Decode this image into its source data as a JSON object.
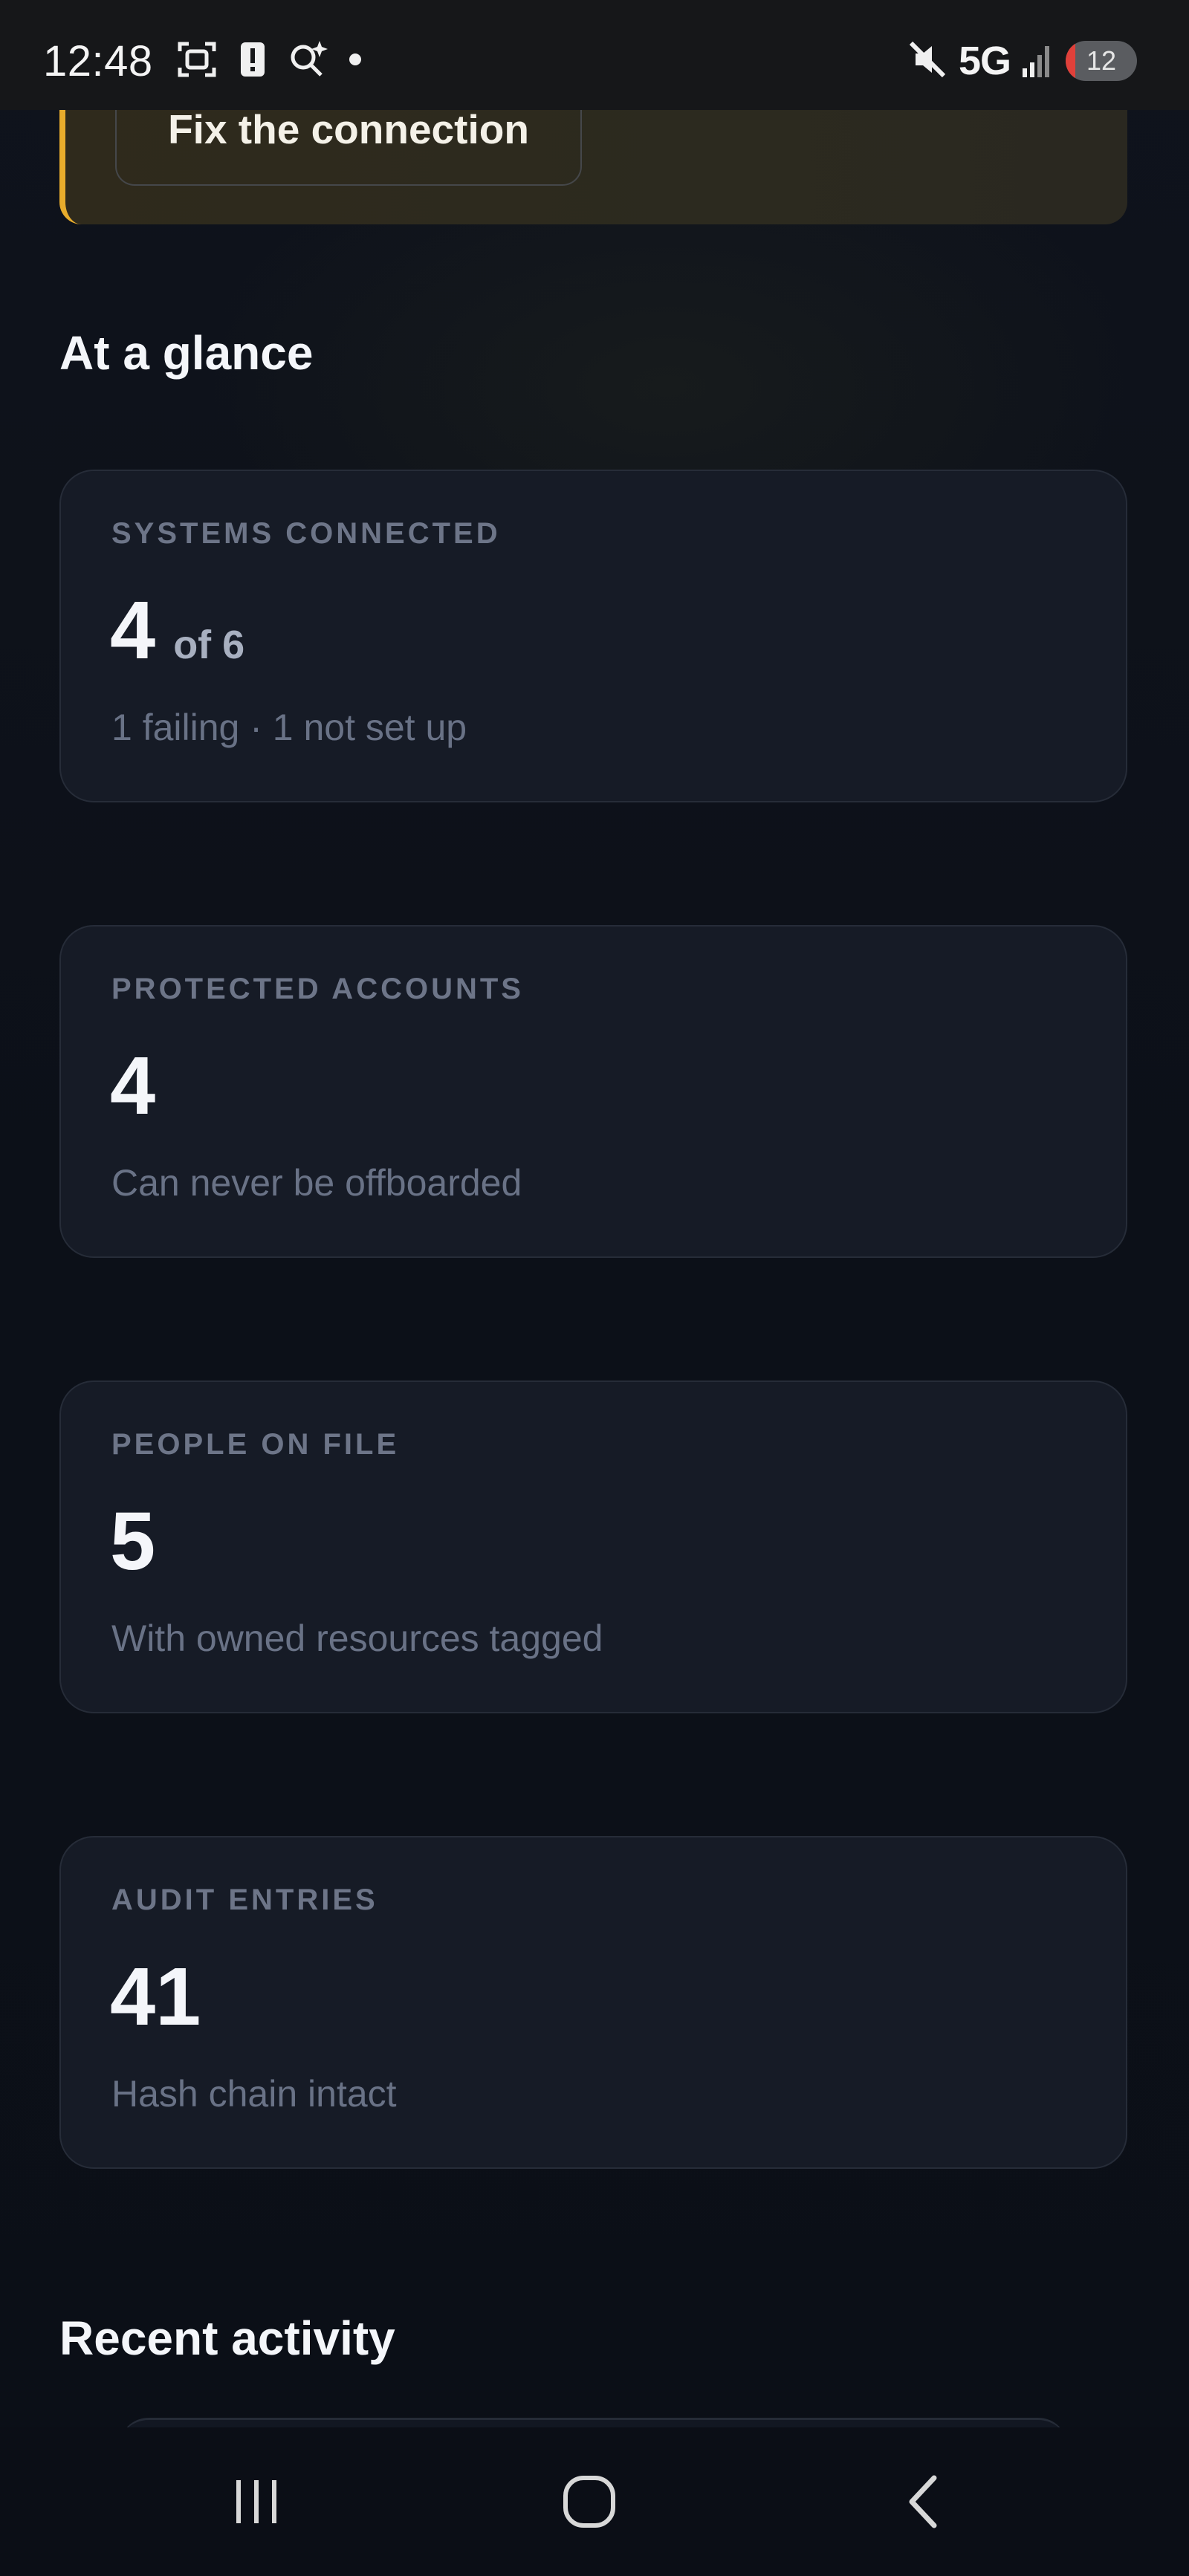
{
  "status_bar": {
    "time": "12:48",
    "network": "5G",
    "battery_level": "12",
    "icons": [
      "screenshot-icon",
      "alert-icon",
      "search-sparkle-icon",
      "notification-dot-icon",
      "mute-icon",
      "signal-icon",
      "battery-icon"
    ]
  },
  "alert": {
    "accent_color": "#e8ac2c",
    "button_label": "Fix the connection"
  },
  "glance": {
    "heading": "At a glance",
    "cards": [
      {
        "label": "SYSTEMS CONNECTED",
        "value": "4",
        "suffix": "of 6",
        "sub": "1 failing · 1 not set up"
      },
      {
        "label": "PROTECTED ACCOUNTS",
        "value": "4",
        "suffix": "",
        "sub": "Can never be offboarded"
      },
      {
        "label": "PEOPLE ON FILE",
        "value": "5",
        "suffix": "",
        "sub": "With owned resources tagged"
      },
      {
        "label": "AUDIT ENTRIES",
        "value": "41",
        "suffix": "",
        "sub": "Hash chain intact"
      }
    ]
  },
  "activity": {
    "heading": "Recent activity"
  },
  "nav": {
    "icons": [
      "recent-apps-icon",
      "home-icon",
      "back-icon"
    ]
  }
}
